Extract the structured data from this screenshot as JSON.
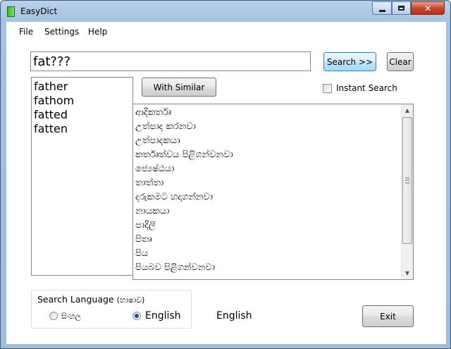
{
  "window": {
    "title": "EasyDict",
    "close_label": "✕"
  },
  "menu": [
    "File",
    "Settings",
    "Help"
  ],
  "search": {
    "value": "fat???",
    "button_label": "Search >>",
    "clear_label": "Clear"
  },
  "with_similar_label": "With Similar",
  "instant_search": {
    "label": "Instant Search",
    "checked": false
  },
  "words": [
    "father",
    "fathom",
    "fatted",
    "fatten"
  ],
  "meanings": [
    "ආදිකර්තෘ",
    "උත්පාද කරනවා",
    "උත්පාදකයා",
    "කර්තෘත්වය පිළිගන්වනවා",
    "ජ්‍යෙෂ්ඨයා",
    "තාත්තා",
    "දරුකමට හදාගන්නවා",
    "නායකයා",
    "පාදිලි",
    "පිතෘ",
    "පිය",
    "පියබව පිළිගන්වනවා"
  ],
  "language_group": {
    "title": "Search Language",
    "title_si": "(භාෂාව)",
    "options": [
      "සිංහල",
      "English"
    ],
    "selected": "English"
  },
  "current_language": "English",
  "exit_label": "Exit"
}
